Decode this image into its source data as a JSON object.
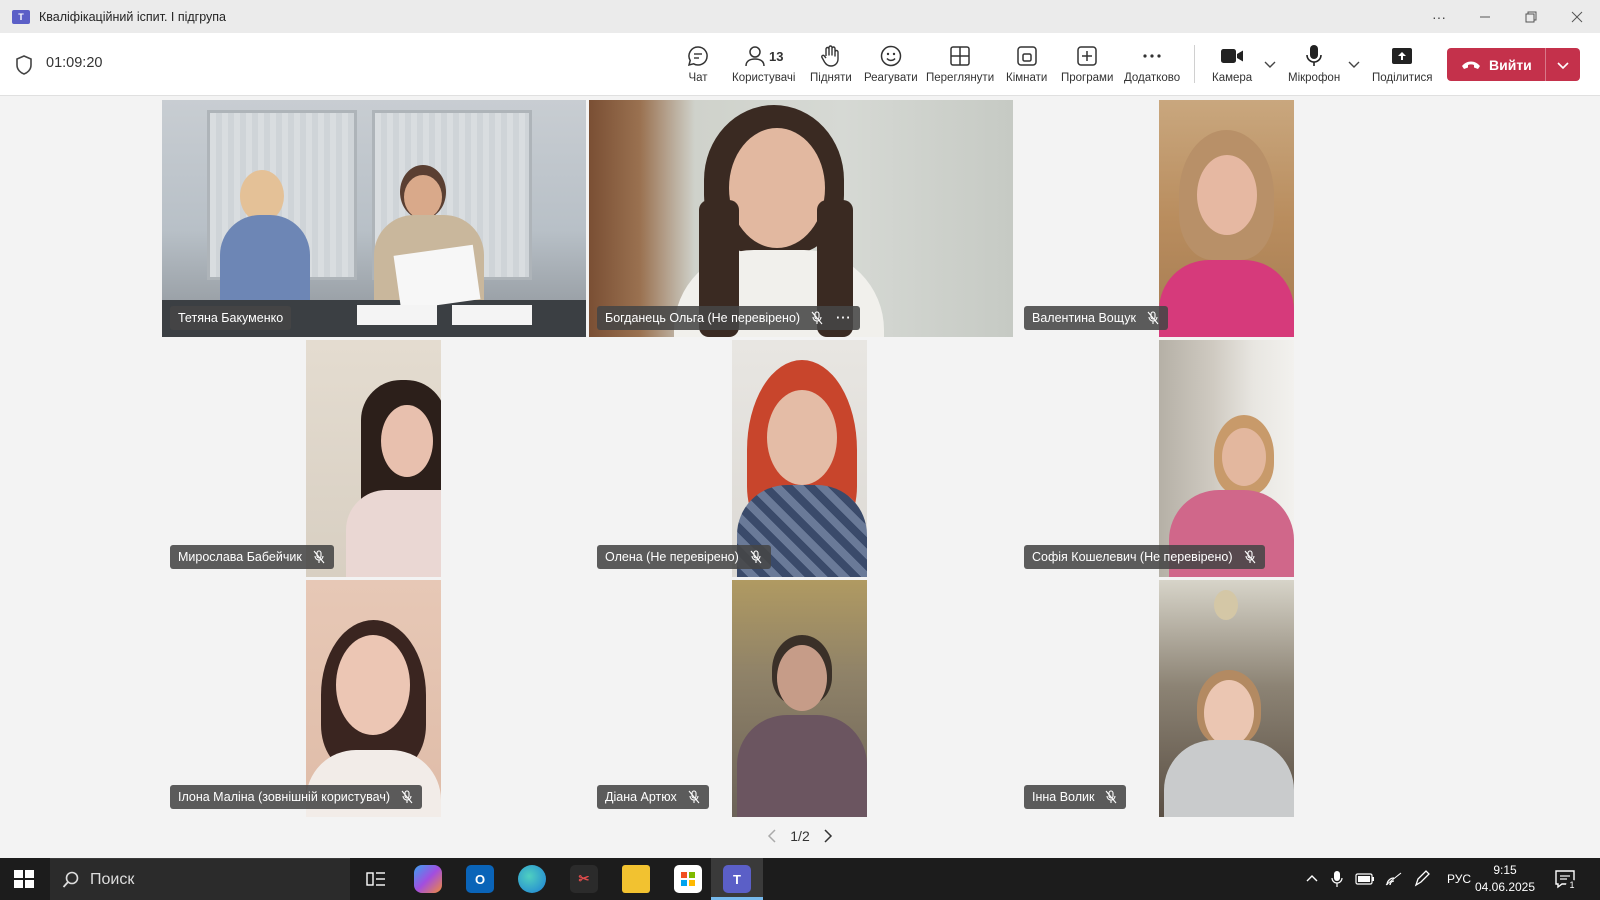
{
  "window": {
    "title": "Кваліфікаційний іспит. І підгрупа",
    "app_logo_text": "T"
  },
  "meeting": {
    "elapsed": "01:09:20",
    "participant_count": "13"
  },
  "toolbar": {
    "chat": "Чат",
    "people": "Користувачі",
    "raise": "Підняти",
    "react": "Реагувати",
    "view": "Переглянути",
    "rooms": "Кімнати",
    "apps": "Програми",
    "more": "Додатково",
    "camera": "Камера",
    "mic": "Мікрофон",
    "share": "Поділитися",
    "leave": "Вийти"
  },
  "participants": [
    {
      "name": "Тетяна Бакуменко",
      "muted": false
    },
    {
      "name": "Богданець Ольга (Не перевірено)",
      "muted": true
    },
    {
      "name": "Валентина Вощук",
      "muted": true
    },
    {
      "name": "Мирослава Бабейчик",
      "muted": true
    },
    {
      "name": "Олена (Не перевірено)",
      "muted": true
    },
    {
      "name": "Софія Кошелевич (Не перевірено)",
      "muted": true
    },
    {
      "name": "Ілона Маліна (зовнішній користувач)",
      "muted": true
    },
    {
      "name": "Діана Артюх",
      "muted": true
    },
    {
      "name": "Інна Волик",
      "muted": true
    }
  ],
  "pager": {
    "label": "1/2"
  },
  "taskbar": {
    "search_placeholder": "Поиск",
    "language": "РУС",
    "time": "9:15",
    "date": "04.06.2025",
    "notifications": "1"
  },
  "colors": {
    "leave": "#c4314b",
    "teams": "#5b5fc7",
    "taskbar": "#1c1c1c"
  }
}
